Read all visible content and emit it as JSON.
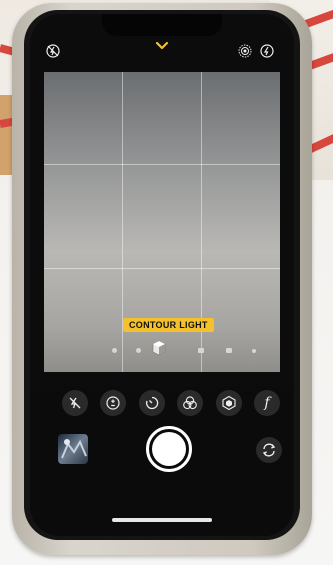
{
  "camera": {
    "portrait_lighting_label": "CONTOUR LIGHT",
    "aperture_icon_label": "f"
  },
  "icons": {
    "top_left": "flash-off-icon",
    "top_center": "chevron-up-icon",
    "top_right_1": "live-photo-icon",
    "top_right_2": "flash-icon",
    "controls": [
      "flash-off-icon",
      "exposure-icon",
      "timer-icon",
      "filters-icon",
      "portrait-lighting-icon",
      "aperture-icon"
    ],
    "bottom_right": "camera-flip-icon"
  },
  "colors": {
    "mode_label_bg": "#f5c12a",
    "chevron": "#f5c12a"
  }
}
